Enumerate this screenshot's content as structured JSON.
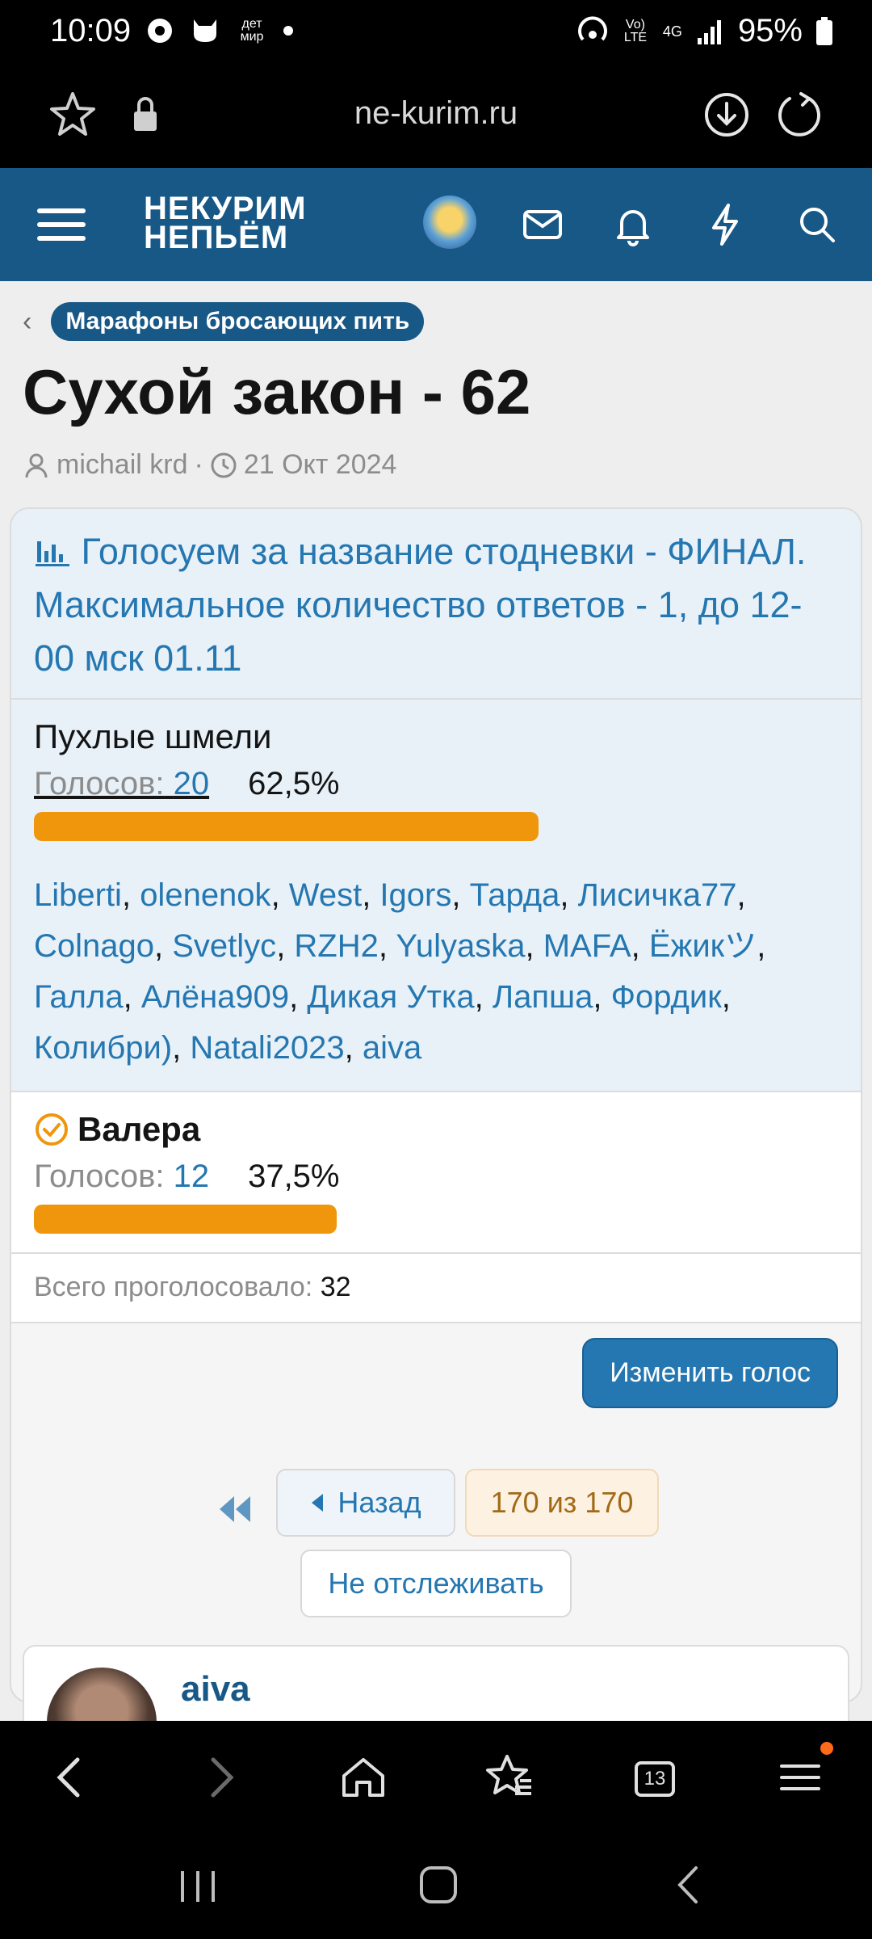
{
  "status_bar": {
    "time": "10:09",
    "badge_text": "дет мир",
    "network": "Vo) LTE",
    "network_type": "4G",
    "battery": "95%"
  },
  "browser": {
    "url": "ne-kurim.ru"
  },
  "site": {
    "logo_line1": "НЕКУРИМ",
    "logo_line2": "НЕПЬЁМ"
  },
  "thread": {
    "breadcrumb": "Марафоны бросающих пить",
    "title": "Сухой закон - 62",
    "author": "michail krd",
    "separator": "·",
    "date": "21 Окт 2024"
  },
  "poll": {
    "question": "Голосуем за название стодневки - ФИНАЛ. Максимальное количество ответов - 1, до 12-00 мск 01.11",
    "options": [
      {
        "name": "Пухлые шмели",
        "votes_label": "Голосов:",
        "votes": "20",
        "percent": "62,5%",
        "fraction_of_max": 0.625,
        "voters": [
          "Liberti",
          "olenenok",
          "West",
          "Igors",
          "Тарда",
          "Лисичка77",
          "Colnago",
          "Svetlyc",
          "RZH2",
          "Yulyaska",
          "MAFA",
          "Ёжикツ",
          "Галла",
          "Алёна909",
          "Дикая Утка",
          "Лапша",
          "Фордик",
          "Колибри)",
          "Natali2023",
          "aiva"
        ]
      },
      {
        "name": "Валера",
        "votes_label": "Голосов:",
        "votes": "12",
        "percent": "37,5%",
        "fraction_of_max": 0.375,
        "selected": true
      }
    ],
    "total_label": "Всего проголосовало:",
    "total": "32",
    "change_vote": "Изменить голос"
  },
  "pagination": {
    "back": "Назад",
    "pages": "170 из 170",
    "unwatch": "Не отслеживать"
  },
  "post": {
    "username": "aiva"
  },
  "bottom_nav": {
    "tabs_count": "13"
  },
  "colors": {
    "header_blue": "#185886",
    "link_blue": "#2577b1",
    "bar_orange": "#f0960d"
  }
}
